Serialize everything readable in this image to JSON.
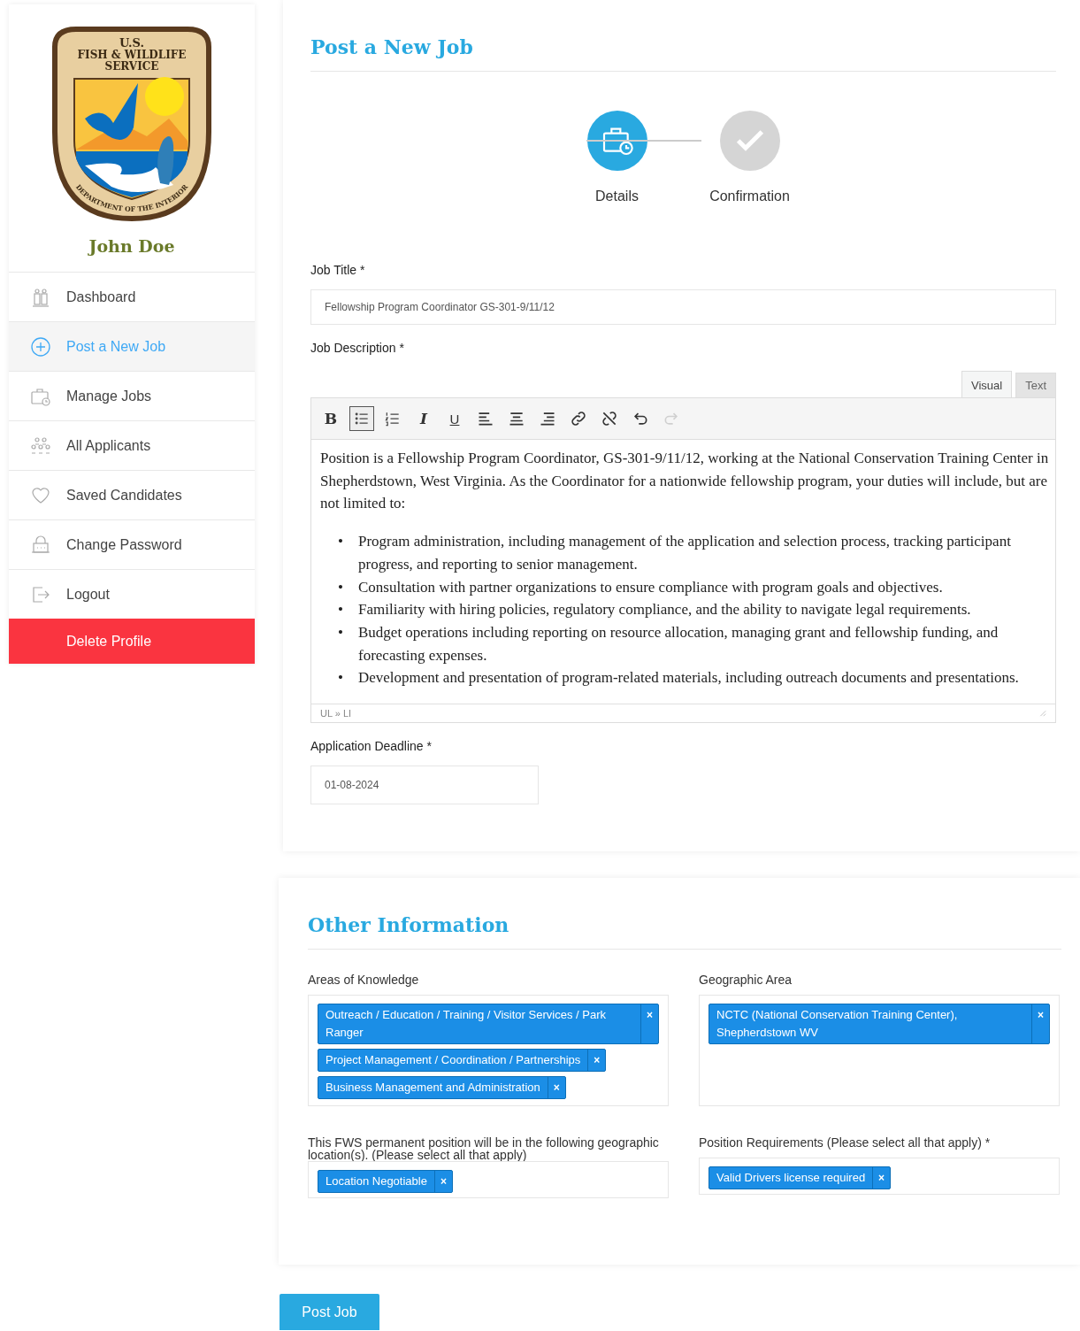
{
  "sidebar": {
    "logo": {
      "top_lines": [
        "U.S.",
        "FISH & WILDLIFE",
        "SERVICE"
      ],
      "ring_text": "DEPARTMENT OF THE INTERIOR"
    },
    "user_name": "John Doe",
    "items": [
      {
        "label": "Dashboard",
        "selected": false
      },
      {
        "label": "Post a New Job",
        "selected": true
      },
      {
        "label": "Manage Jobs",
        "selected": false
      },
      {
        "label": "All Applicants",
        "selected": false
      },
      {
        "label": "Saved Candidates",
        "selected": false
      },
      {
        "label": "Change Password",
        "selected": false
      },
      {
        "label": "Logout",
        "selected": false
      }
    ],
    "delete_button": "Delete Profile"
  },
  "main": {
    "title": "Post a New Job",
    "steps": [
      {
        "label": "Details",
        "selected": true
      },
      {
        "label": "Confirmation",
        "selected": false
      }
    ],
    "job_title": {
      "label": "Job Title *",
      "value": "Fellowship Program Coordinator GS-301-9/11/12"
    },
    "job_description": {
      "label": "Job Description *",
      "editor_tabs": [
        {
          "label": "Visual",
          "selected": true
        },
        {
          "label": "Text",
          "selected": false
        }
      ],
      "toolbar": [
        {
          "kind": "bold",
          "label": "B",
          "selected": false,
          "disabled": false
        },
        {
          "kind": "bullets",
          "selected": true,
          "disabled": false
        },
        {
          "kind": "numbers",
          "selected": false,
          "disabled": false
        },
        {
          "kind": "italic",
          "label": "I",
          "selected": false,
          "disabled": false
        },
        {
          "kind": "underline",
          "label": "U",
          "selected": false,
          "disabled": false
        },
        {
          "kind": "alignleft",
          "selected": false,
          "disabled": false
        },
        {
          "kind": "aligncenter",
          "selected": false,
          "disabled": false
        },
        {
          "kind": "alignright",
          "selected": false,
          "disabled": false
        },
        {
          "kind": "link",
          "selected": false,
          "disabled": false
        },
        {
          "kind": "unlink",
          "selected": false,
          "disabled": false
        },
        {
          "kind": "undo",
          "selected": false,
          "disabled": false
        },
        {
          "kind": "redo",
          "selected": false,
          "disabled": true
        }
      ],
      "paragraph": "Position is a Fellowship Program Coordinator, GS-301-9/11/12, working at the National Conservation Training Center in Shepherdstown, West Virginia. As the Coordinator for a nationwide fellowship program, your duties will include, but are not limited to:",
      "bullets": [
        {
          "marker": "•",
          "text": "Program administration, including management of the application and selection process, tracking participant progress, and reporting to senior management."
        },
        {
          "marker": "•",
          "text": "Consultation with partner organizations to ensure compliance with program goals and objectives."
        },
        {
          "marker": "•",
          "text": "Familiarity with hiring policies, regulatory compliance, and the ability to navigate legal requirements."
        },
        {
          "marker": "•",
          "text": "Budget operations including reporting on resource allocation, managing grant and fellowship funding, and forecasting expenses."
        },
        {
          "marker": "•",
          "text": "Development and presentation of program-related materials, including outreach documents and presentations."
        }
      ],
      "path": "UL » LI"
    },
    "deadline": {
      "label": "Application Deadline *",
      "value": "01-08-2024"
    }
  },
  "other": {
    "title": "Other Information",
    "fields": [
      {
        "label": "Areas of Knowledge",
        "tags": [
          "Outreach / Education / Training / Visitor Services / Park Ranger",
          "Project Management / Coordination / Partnerships",
          "Business Management and Administration"
        ]
      },
      {
        "label": "Geographic Area",
        "tags": [
          "NCTC (National Conservation Training Center), Shepherdstown WV"
        ]
      },
      {
        "label": "This FWS permanent position will be in the following geographic location(s). (Please select all that apply)",
        "tags": [
          "Location Negotiable"
        ]
      },
      {
        "label": "Position Requirements (Please select all that apply) *",
        "tags": [
          "Valid Drivers license required"
        ]
      }
    ],
    "remove_mark": "×"
  },
  "submit_button": "Post Job"
}
